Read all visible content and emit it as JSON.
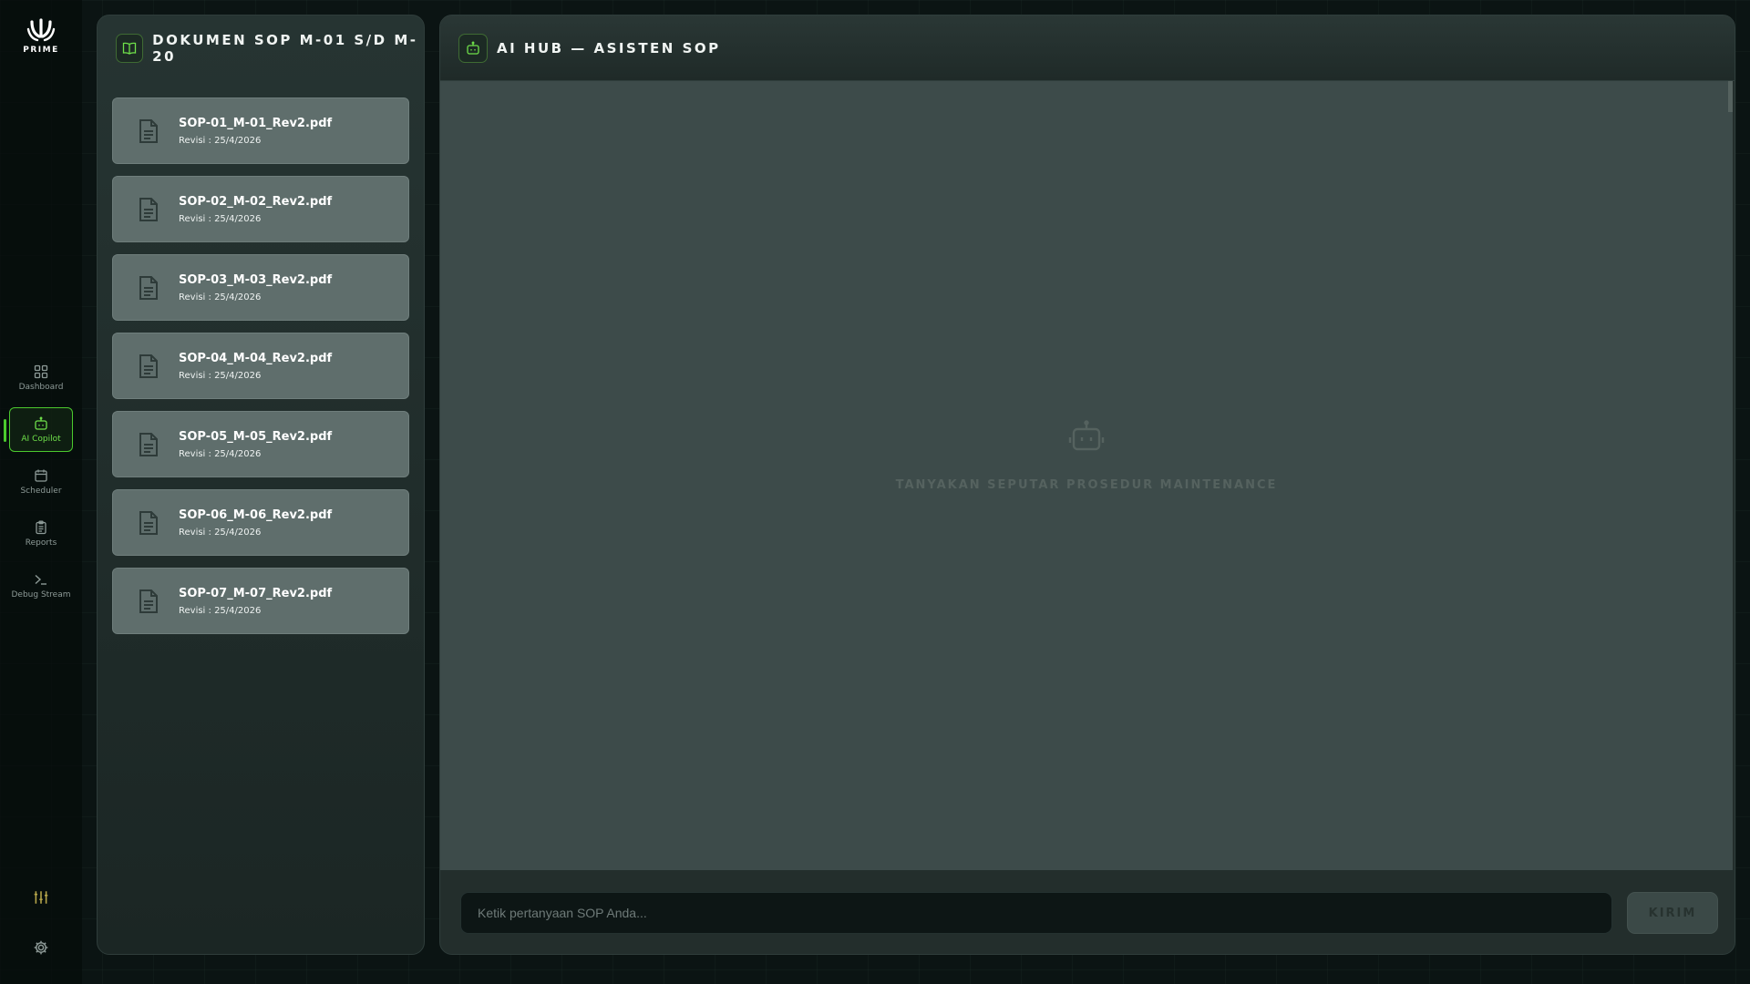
{
  "brand": {
    "logo_text": "PRIME"
  },
  "nav": {
    "items": [
      {
        "label": "Dashboard",
        "icon": "grid-icon",
        "active": false
      },
      {
        "label": "AI Copilot",
        "icon": "robot-icon",
        "active": true
      },
      {
        "label": "Scheduler",
        "icon": "calendar-icon",
        "active": false
      },
      {
        "label": "Reports",
        "icon": "clipboard-icon",
        "active": false
      },
      {
        "label": "Debug Stream",
        "icon": "terminal-icon",
        "active": false
      }
    ],
    "bottom_icons": [
      "sliders-icon",
      "gear-icon"
    ]
  },
  "docs_panel": {
    "title": "DOKUMEN SOP M-01 S/D M-20",
    "icon": "book-icon",
    "documents": [
      {
        "name": "SOP-01_M-01_Rev2.pdf",
        "revision": "Revisi : 25/4/2026"
      },
      {
        "name": "SOP-02_M-02_Rev2.pdf",
        "revision": "Revisi : 25/4/2026"
      },
      {
        "name": "SOP-03_M-03_Rev2.pdf",
        "revision": "Revisi : 25/4/2026"
      },
      {
        "name": "SOP-04_M-04_Rev2.pdf",
        "revision": "Revisi : 25/4/2026"
      },
      {
        "name": "SOP-05_M-05_Rev2.pdf",
        "revision": "Revisi : 25/4/2026"
      },
      {
        "name": "SOP-06_M-06_Rev2.pdf",
        "revision": "Revisi : 25/4/2026"
      },
      {
        "name": "SOP-07_M-07_Rev2.pdf",
        "revision": "Revisi : 25/4/2026"
      }
    ]
  },
  "chat": {
    "title": "AI HUB — ASISTEN SOP",
    "icon": "robot-icon",
    "empty_state": "TANYAKAN SEPUTAR PROSEDUR MAINTENANCE",
    "input": {
      "value": "",
      "placeholder": "Ketik pertanyaan SOP Anda..."
    },
    "send_label": "KIRIM"
  },
  "colors": {
    "accent": "#4bc92e",
    "background": "#0b1413",
    "card": "#5f6e6c",
    "chat_body": "#3d4b4a"
  }
}
